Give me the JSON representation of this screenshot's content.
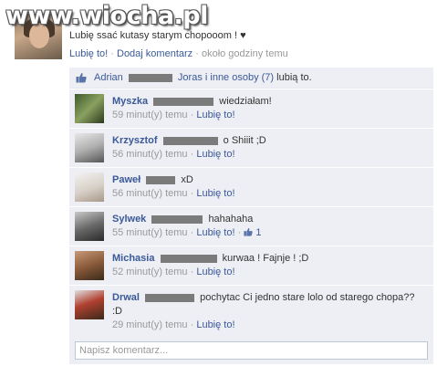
{
  "watermark": "www.wiocha.pl",
  "status": {
    "text": "Lubię ssać kutasy starym chopooom ! ♥",
    "like": "Lubię to!",
    "comment": "Dodaj komentarz",
    "time": "około godziny temu"
  },
  "likes": {
    "first_name": "Adrian",
    "rest": "Joras i inne osoby (7)",
    "suffix": "lubią to."
  },
  "comments": [
    {
      "name": "Myszka",
      "text": "wiedziałam!",
      "time": "59 minut(y) temu",
      "like": "Lubię to!"
    },
    {
      "name": "Krzysztof",
      "text": "o Shiiit ;D",
      "time": "56 minut(y) temu",
      "like": "Lubię to!"
    },
    {
      "name": "Paweł",
      "text": "xD",
      "time": "56 minut(y) temu",
      "like": "Lubię to!"
    },
    {
      "name": "Sylwek",
      "text": "hahahaha",
      "time": "55 minut(y) temu",
      "like": "Lubię to!",
      "like_count": "1"
    },
    {
      "name": "Michasia",
      "text": "kurwaa ! Fajnje ! ;D",
      "time": "52 minut(y) temu",
      "like": "Lubię to!"
    },
    {
      "name": "Drwal",
      "text": "pochytac Ci jedno stare lolo od starego chopa??",
      "text2": ":D",
      "time": "29 minut(y) temu",
      "like": "Lubię to!"
    }
  ],
  "write": {
    "placeholder": "Napisz komentarz..."
  },
  "colors": {
    "link": "#3b5998",
    "box": "#edeff4",
    "meta": "#999999"
  },
  "icons": [
    "thumbs-up-icon"
  ]
}
